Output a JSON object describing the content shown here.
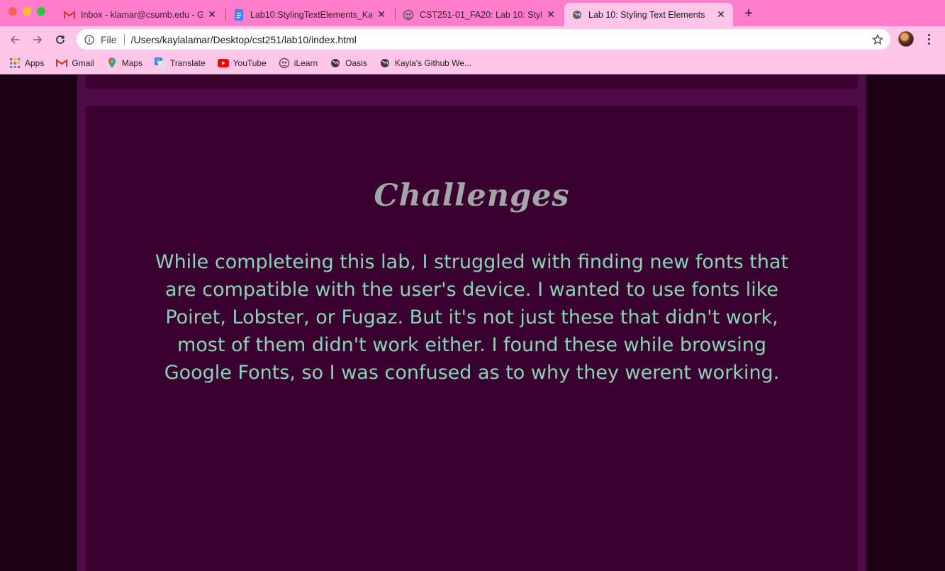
{
  "browser": {
    "tabs": [
      {
        "title": "Inbox - klamar@csumb.edu - G",
        "icon": "gmail-icon",
        "active": false
      },
      {
        "title": "Lab10:StylingTextElements_Ka",
        "icon": "google-docs-icon",
        "active": false
      },
      {
        "title": "CST251-01_FA20: Lab 10: Styli",
        "icon": "ilearn-icon",
        "active": false
      },
      {
        "title": "Lab 10: Styling Text Elements",
        "icon": "globe-icon",
        "active": true
      }
    ],
    "new_tab_label": "+",
    "address": {
      "scheme_label": "File",
      "url": "/Users/kaylalamar/Desktop/cst251/lab10/index.html"
    },
    "bookmarks": [
      {
        "label": "Apps",
        "icon": "apps-grid-icon"
      },
      {
        "label": "Gmail",
        "icon": "gmail-icon"
      },
      {
        "label": "Maps",
        "icon": "maps-pin-icon"
      },
      {
        "label": "Translate",
        "icon": "translate-icon"
      },
      {
        "label": "YouTube",
        "icon": "youtube-icon"
      },
      {
        "label": "iLearn",
        "icon": "ilearn-icon"
      },
      {
        "label": "Oasis",
        "icon": "globe-icon"
      },
      {
        "label": "Kayla's Github We...",
        "icon": "globe-icon"
      }
    ],
    "colors": {
      "tab_strip": "#ff7ecb",
      "toolbar": "#ffc6ea"
    }
  },
  "page": {
    "heading": "Challenges",
    "paragraph": "While completeing this lab, I struggled with finding new fonts that are compatible with the user's device. I wanted to use fonts like Poiret, Lobster, or Fugaz. But it's not just these that didn't work, most of them didn't work either. I found these while browsing Google Fonts, so I was confused as to why they werent working.",
    "colors": {
      "background": "#1c0013",
      "container": "#4f0b46",
      "box": "#3a0030",
      "heading": "#a2a4a5",
      "paragraph": "#8bd3b6"
    }
  }
}
